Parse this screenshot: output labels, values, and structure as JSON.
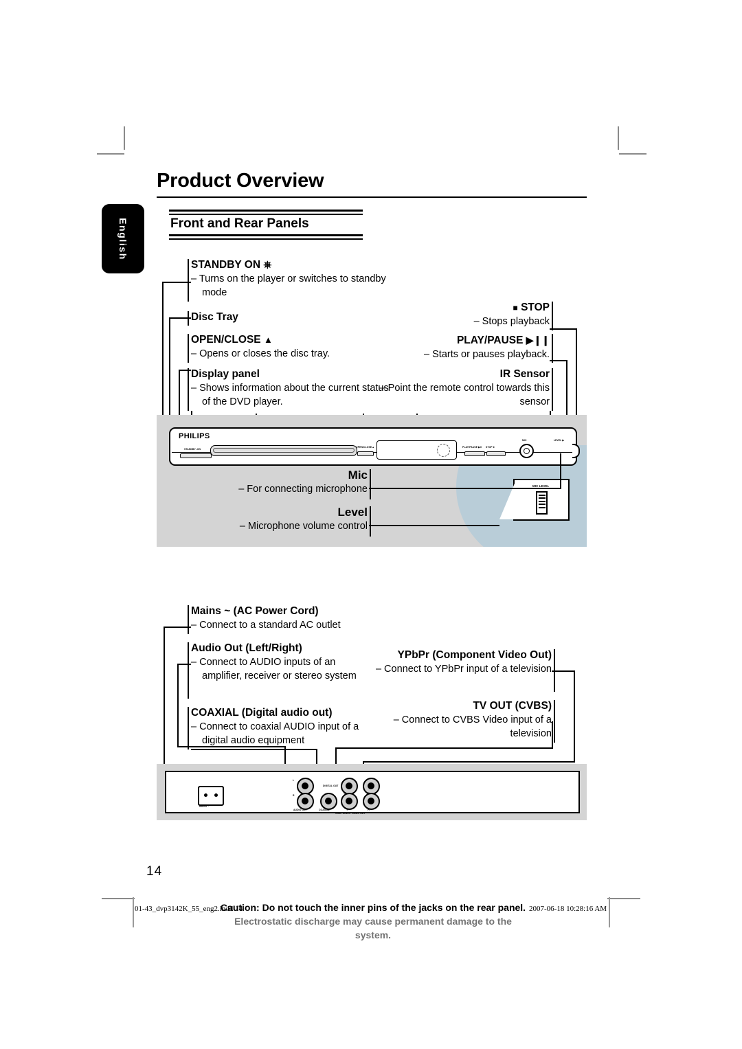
{
  "page": {
    "title": "Product Overview",
    "section_title": "Front and Rear Panels",
    "language_tab": "English",
    "page_number": "14"
  },
  "front_callouts": [
    {
      "id": "standby-on",
      "term": "STANDBY ON",
      "icon": "power-icon",
      "desc": "–  Turns on the player or switches to standby mode"
    },
    {
      "id": "disc-tray",
      "term": "Disc Tray",
      "desc": ""
    },
    {
      "id": "open-close",
      "term": "OPEN/CLOSE",
      "icon": "eject-icon",
      "desc": "–  Opens or closes the disc tray."
    },
    {
      "id": "display-panel",
      "term": "Display panel",
      "desc": "–  Shows information about the current status of the DVD player."
    },
    {
      "id": "stop",
      "term": "STOP",
      "icon": "stop-icon",
      "desc": "– Stops playback"
    },
    {
      "id": "play-pause",
      "term": "PLAY/PAUSE",
      "icon": "play-pause-icon",
      "desc": "– Starts or pauses playback."
    },
    {
      "id": "ir-sensor",
      "term": "IR Sensor",
      "desc": "– Point the remote control towards this sensor"
    },
    {
      "id": "mic",
      "term": "Mic",
      "desc": "– For connecting microphone"
    },
    {
      "id": "level",
      "term": "Level",
      "desc": "– Microphone volume control"
    }
  ],
  "rear_callouts": [
    {
      "id": "mains",
      "term": "Mains ~ (AC Power Cord)",
      "desc": "–  Connect to a standard AC outlet"
    },
    {
      "id": "audio-out",
      "term": "Audio Out (Left/Right)",
      "desc": "–  Connect to AUDIO inputs of an amplifier, receiver or stereo system"
    },
    {
      "id": "coaxial",
      "term": "COAXIAL (Digital audio out)",
      "desc": "–  Connect to coaxial AUDIO input of a digital audio equipment"
    },
    {
      "id": "ypbpr",
      "term": "YPbPr (Component Video Out)",
      "desc": "– Connect to YPbPr input of a television"
    },
    {
      "id": "tv-out",
      "term": "TV OUT (CVBS)",
      "desc": "– Connect to CVBS Video input of a television"
    }
  ],
  "front_panel_art": {
    "brand": "PHILIPS",
    "labels": {
      "standby": "STANDBY–ON",
      "open_close": "OPEN/CLOSE ▴",
      "play_pause": "PLAY/PAUSE ▶II",
      "stop": "STOP ■",
      "mic": "MIC",
      "level": "LEVEL ▶"
    },
    "inset_label": "MIC LEVEL"
  },
  "rear_panel_art": {
    "labels": {
      "mains": "MAINS ~",
      "audio_l": "L",
      "audio_r": "R",
      "audio_out": "AUDIO OUT",
      "digital_out": "DIGITAL OUT",
      "coaxial": "COAXIAL",
      "tv_out": "TV OUT",
      "y": "Y",
      "pb": "Pb",
      "pr": "Pr",
      "component": "COMPONENT VIDEO OUT"
    }
  },
  "footer": {
    "caution_line1": "Caution: Do not touch the inner pins of the jacks on the rear panel.",
    "caution_line2": "Electrostatic discharge may cause permanent damage to the system.",
    "file_name": "01-43_dvp3142K_55_eng2.indd   14",
    "timestamp": "2007-06-18   10:28:16 AM"
  },
  "colors": {
    "panel_grey": "#d4d4d4",
    "accent_blue": "#b9cdd8",
    "ink": "#000000"
  }
}
